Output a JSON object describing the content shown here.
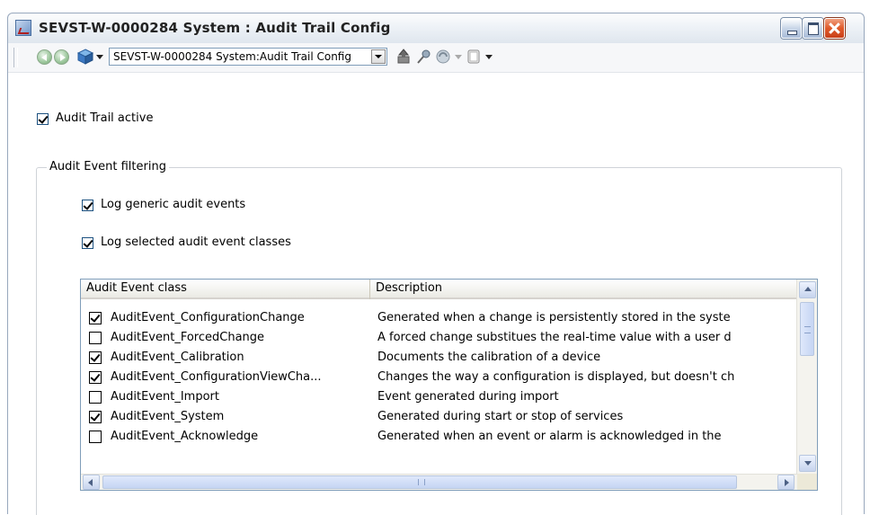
{
  "window": {
    "title": "SEVST-W-0000284 System : Audit Trail Config"
  },
  "toolbar": {
    "address_value": "SEVST-W-0000284 System:Audit Trail Config",
    "icons": [
      "back-icon",
      "forward-icon",
      "object-cube-icon",
      "import-icon",
      "pin-icon",
      "filter-icon",
      "view-icon"
    ]
  },
  "audit_trail": {
    "active_label": "Audit Trail active",
    "active_checked": true
  },
  "filtering": {
    "group_title": "Audit Event filtering",
    "generic_label": "Log generic audit events",
    "generic_checked": true,
    "selected_label": "Log selected audit event classes",
    "selected_checked": true
  },
  "event_list": {
    "columns": [
      "Audit Event class",
      "Description"
    ],
    "rows": [
      {
        "name": "AuditEvent_ConfigurationChange",
        "checked": true,
        "description": "Generated when a change is persistently stored in the syste"
      },
      {
        "name": "AuditEvent_ForcedChange",
        "checked": false,
        "description": "A forced change substitues the real-time value with a user d"
      },
      {
        "name": "AuditEvent_Calibration",
        "checked": true,
        "description": "Documents the calibration of a device"
      },
      {
        "name": "AuditEvent_ConfigurationViewCha...",
        "checked": true,
        "description": "Changes the way a configuration is displayed, but doesn't ch"
      },
      {
        "name": "AuditEvent_Import",
        "checked": false,
        "description": "Event generated during import"
      },
      {
        "name": "AuditEvent_System",
        "checked": true,
        "description": "Generated during start or stop of services"
      },
      {
        "name": "AuditEvent_Acknowledge",
        "checked": false,
        "description": "Generated when an event or alarm is acknowledged in the"
      }
    ]
  }
}
